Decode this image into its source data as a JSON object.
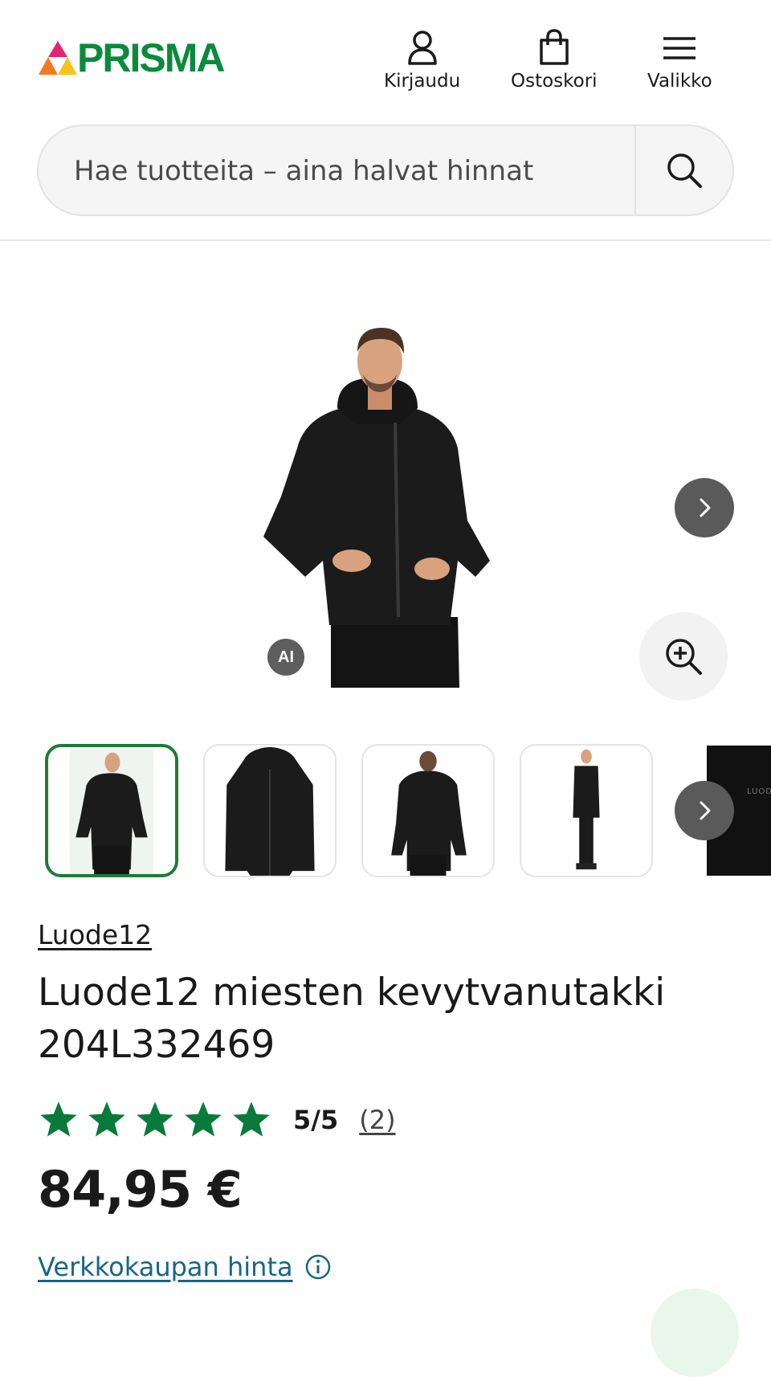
{
  "header": {
    "logo_text": "PRISMA",
    "nav": [
      {
        "label": "Kirjaudu",
        "icon": "user-icon"
      },
      {
        "label": "Ostoskori",
        "icon": "shopping-bag-icon"
      },
      {
        "label": "Valikko",
        "icon": "menu-icon"
      }
    ]
  },
  "search": {
    "placeholder": "Hae tuotteita – aina halvat hinnat",
    "icon": "search-icon"
  },
  "gallery": {
    "ai_badge": "AI",
    "thumbnail_count_visible": 5,
    "active_index": 0,
    "thumb_partial_text": "LUODE"
  },
  "product": {
    "brand": "Luode12",
    "title": "Luode12 miesten kevytvanutakki 204L332469",
    "rating_score": "5/5",
    "review_count": "(2)",
    "stars": 5,
    "price": "84,95 €",
    "price_note": "Verkkokaupan hinta"
  },
  "colors": {
    "brand_green": "#0b8a3b",
    "star_green": "#0a7a3a",
    "link_blue": "#17658a"
  }
}
